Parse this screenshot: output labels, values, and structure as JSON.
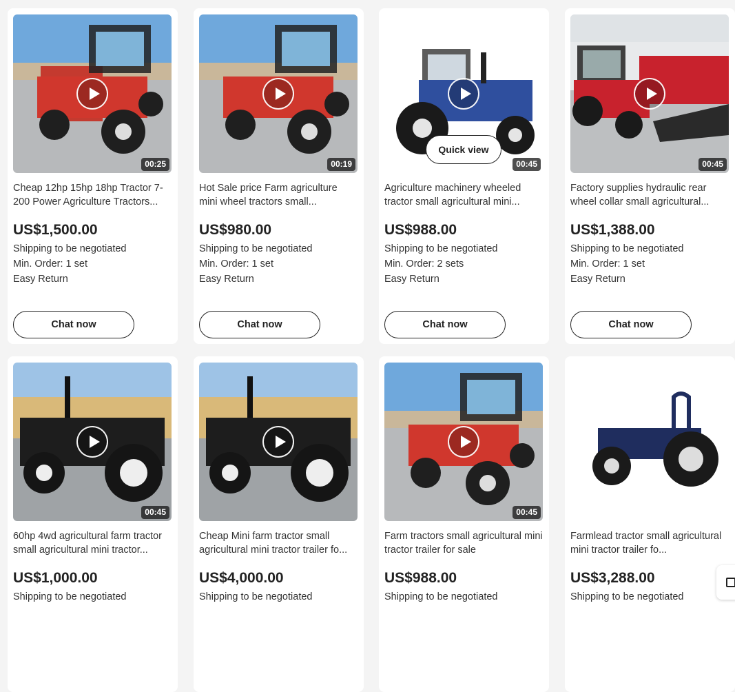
{
  "products": [
    {
      "title": "Cheap 12hp 15hp 18hp Tractor 7-200 Power Agriculture Tractors...",
      "price": "US$1,500.00",
      "shipping": "Shipping to be negotiated",
      "min_order": "Min. Order: 1 set",
      "easy_return": "Easy Return",
      "duration": "00:25",
      "chat_label": "Chat now",
      "has_video": true
    },
    {
      "title": "Hot Sale price Farm agriculture mini wheel tractors small...",
      "price": "US$980.00",
      "shipping": "Shipping to be negotiated",
      "min_order": "Min. Order: 1 set",
      "easy_return": "Easy Return",
      "duration": "00:19",
      "chat_label": "Chat now",
      "has_video": true
    },
    {
      "title": "Agriculture machinery wheeled tractor small agricultural mini...",
      "price": "US$988.00",
      "shipping": "Shipping to be negotiated",
      "min_order": "Min. Order: 2 sets",
      "easy_return": "Easy Return",
      "duration": "00:45",
      "chat_label": "Chat now",
      "quick_view": "Quick view",
      "has_video": true
    },
    {
      "title": "Factory supplies hydraulic rear wheel collar small agricultural...",
      "price": "US$1,388.00",
      "shipping": "Shipping to be negotiated",
      "min_order": "Min. Order: 1 set",
      "easy_return": "Easy Return",
      "duration": "00:45",
      "chat_label": "Chat now",
      "has_video": true
    },
    {
      "title": "60hp 4wd agricultural farm tractor small agricultural mini tractor...",
      "price": "US$1,000.00",
      "shipping": "Shipping to be negotiated",
      "duration": "00:45",
      "has_video": true
    },
    {
      "title": "Cheap Mini farm tractor small agricultural mini tractor trailer fo...",
      "price": "US$4,000.00",
      "shipping": "Shipping to be negotiated",
      "has_video": true
    },
    {
      "title": "Farm tractors small agricultural mini tractor trailer for sale",
      "price": "US$988.00",
      "shipping": "Shipping to be negotiated",
      "duration": "00:45",
      "has_video": true
    },
    {
      "title": "Farmlead tractor small agricultural mini tractor trailer fo...",
      "price": "US$3,288.00",
      "shipping": "Shipping to be negotiated",
      "has_video": false
    }
  ],
  "icons": {
    "play": "play-icon",
    "floating": "feedback-icon"
  },
  "colors": {
    "page_bg": "#f4f4f4",
    "card_bg": "#ffffff",
    "text": "#222222"
  }
}
